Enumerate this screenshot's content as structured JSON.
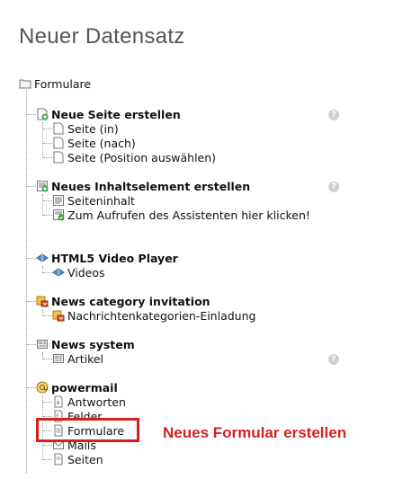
{
  "heading": "Neuer Datensatz",
  "root": {
    "label": "Formulare",
    "icon": "folder-icon"
  },
  "groups": [
    {
      "label": "Neue Seite erstellen",
      "icon": "page-add-icon",
      "has_help": true,
      "items": [
        {
          "label": "Seite (in)",
          "icon": "page-icon"
        },
        {
          "label": "Seite (nach)",
          "icon": "page-icon"
        },
        {
          "label": "Seite (Position auswählen)",
          "icon": "page-icon"
        }
      ]
    },
    {
      "label": "Neues Inhaltselement erstellen",
      "icon": "content-add-icon",
      "has_help": true,
      "items": [
        {
          "label": "Seiteninhalt",
          "icon": "content-icon"
        },
        {
          "label": "Zum Aufrufen des Assistenten hier klicken!",
          "icon": "wizard-icon"
        }
      ]
    },
    {
      "label": "HTML5 Video Player",
      "icon": "video-icon",
      "has_help": false,
      "items": [
        {
          "label": "Videos",
          "icon": "video-icon"
        }
      ]
    },
    {
      "label": "News category invitation",
      "icon": "news-category-icon",
      "has_help": false,
      "items": [
        {
          "label": "Nachrichtenkategorien-Einladung",
          "icon": "news-category-icon"
        }
      ]
    },
    {
      "label": "News system",
      "icon": "news-icon",
      "has_help": false,
      "items": [
        {
          "label": "Artikel",
          "icon": "news-icon"
        }
      ],
      "help_on_item": true
    },
    {
      "label": "powermail",
      "icon": "powermail-icon",
      "has_help": false,
      "items": [
        {
          "label": "Antworten",
          "icon": "answer-icon"
        },
        {
          "label": "Felder",
          "icon": "field-icon"
        },
        {
          "label": "Formulare",
          "icon": "form-icon"
        },
        {
          "label": "Mails",
          "icon": "mail-icon"
        },
        {
          "label": "Seiten",
          "icon": "pages-icon"
        }
      ]
    }
  ],
  "help_glyph": "?",
  "annotation": {
    "text": "Neues Formular erstellen",
    "color": "#d81e1e"
  }
}
